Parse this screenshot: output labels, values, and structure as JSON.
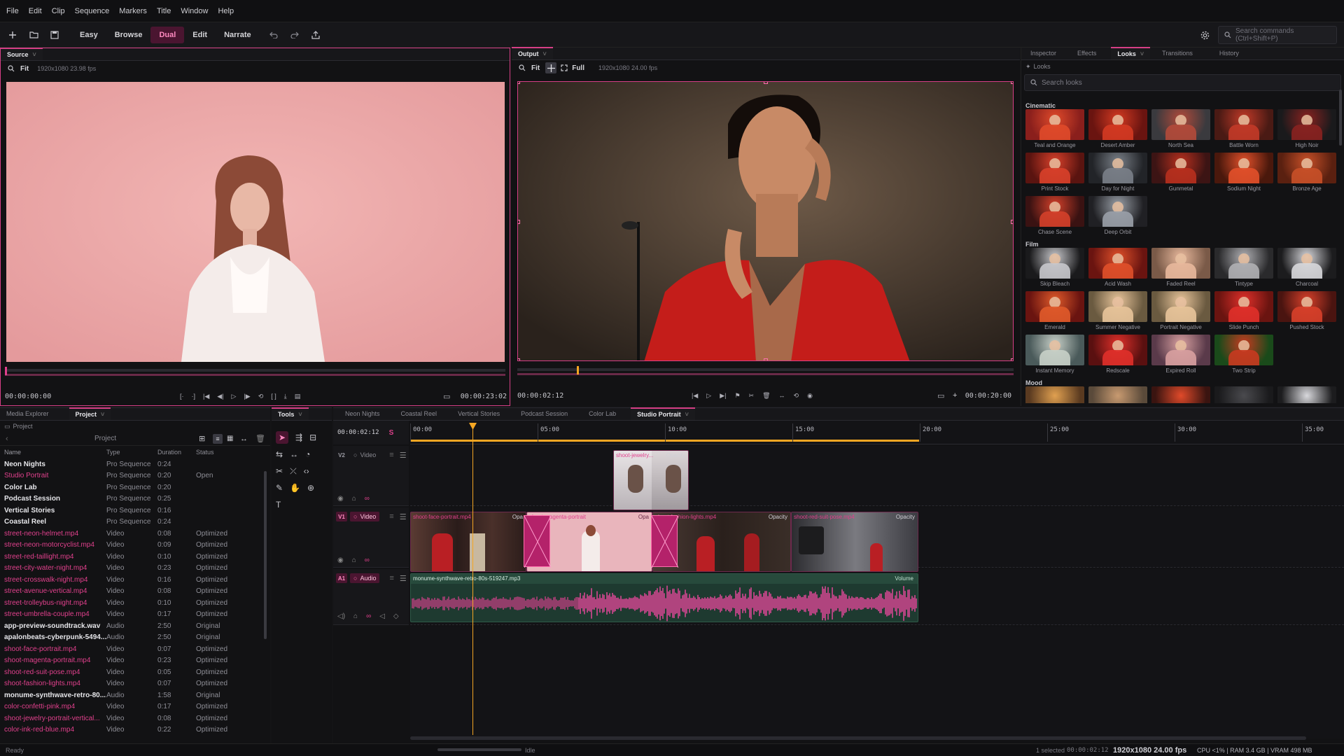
{
  "menu": [
    "File",
    "Edit",
    "Clip",
    "Sequence",
    "Markers",
    "Title",
    "Window",
    "Help"
  ],
  "toolbar": {
    "workspaces": [
      "Easy",
      "Browse",
      "Dual",
      "Edit",
      "Narrate"
    ],
    "active_workspace": "Dual",
    "search_placeholder": "Search commands (Ctrl+Shift+P)"
  },
  "source": {
    "tab": "Source",
    "fit": "Fit",
    "info": "1920x1080  23.98 fps",
    "timecode_in": "00:00:00:00",
    "timecode_out": "00:00:23:02",
    "progress": 0.0
  },
  "output": {
    "tab": "Output",
    "fit": "Fit",
    "full": "Full",
    "info": "1920x1080  24.00 fps",
    "timecode_in": "00:00:02:12",
    "timecode_out": "00:00:20:00",
    "progress": 0.12
  },
  "right_panel": {
    "tabs": [
      "Inspector",
      "Effects",
      "Looks",
      "Transitions",
      "History"
    ],
    "active_tab": "Looks",
    "crumb": "Looks",
    "search_placeholder": "Search looks",
    "sections": [
      {
        "title": "Cinematic",
        "items": [
          "Teal and Orange",
          "Desert Amber",
          "North Sea",
          "Battle Worn",
          "High Noir",
          "Print Stock",
          "Day for Night",
          "Gunmetal",
          "Sodium Night",
          "Bronze Age",
          "Chase Scene",
          "Deep Orbit"
        ]
      },
      {
        "title": "Film",
        "items": [
          "Skip Bleach",
          "Acid Wash",
          "Faded Reel",
          "Tintype",
          "Charcoal",
          "Emerald",
          "Summer Negative",
          "Portrait Negative",
          "Slide Punch",
          "Pushed Stock",
          "Instant Memory",
          "Redscale",
          "Expired Roll",
          "Two Strip"
        ]
      },
      {
        "title": "Mood",
        "items": []
      }
    ]
  },
  "project_panel": {
    "tabs": [
      "Media Explorer",
      "Project"
    ],
    "active_tab": "Project",
    "crumb": "Project",
    "header": "Project",
    "columns": [
      "Name",
      "Type",
      "Duration",
      "Status"
    ],
    "rows": [
      {
        "name": "Neon Nights",
        "type": "Pro Sequence",
        "duration": "0:24",
        "status": ""
      },
      {
        "name": "Studio Portrait",
        "type": "Pro Sequence",
        "duration": "0:20",
        "status": "Open"
      },
      {
        "name": "Color Lab",
        "type": "Pro Sequence",
        "duration": "0:20",
        "status": ""
      },
      {
        "name": "Podcast Session",
        "type": "Pro Sequence",
        "duration": "0:25",
        "status": ""
      },
      {
        "name": "Vertical Stories",
        "type": "Pro Sequence",
        "duration": "0:16",
        "status": ""
      },
      {
        "name": "Coastal Reel",
        "type": "Pro Sequence",
        "duration": "0:24",
        "status": ""
      },
      {
        "name": "street-neon-helmet.mp4",
        "type": "Video",
        "duration": "0:08",
        "status": "Optimized"
      },
      {
        "name": "street-neon-motorcyclist.mp4",
        "type": "Video",
        "duration": "0:09",
        "status": "Optimized"
      },
      {
        "name": "street-red-taillight.mp4",
        "type": "Video",
        "duration": "0:10",
        "status": "Optimized"
      },
      {
        "name": "street-city-water-night.mp4",
        "type": "Video",
        "duration": "0:23",
        "status": "Optimized"
      },
      {
        "name": "street-crosswalk-night.mp4",
        "type": "Video",
        "duration": "0:16",
        "status": "Optimized"
      },
      {
        "name": "street-avenue-vertical.mp4",
        "type": "Video",
        "duration": "0:08",
        "status": "Optimized"
      },
      {
        "name": "street-trolleybus-night.mp4",
        "type": "Video",
        "duration": "0:10",
        "status": "Optimized"
      },
      {
        "name": "street-umbrella-couple.mp4",
        "type": "Video",
        "duration": "0:17",
        "status": "Optimized"
      },
      {
        "name": "app-preview-soundtrack.wav",
        "type": "Audio",
        "duration": "2:50",
        "status": "Original"
      },
      {
        "name": "apalonbeats-cyberpunk-5494...",
        "type": "Audio",
        "duration": "2:50",
        "status": "Original"
      },
      {
        "name": "shoot-face-portrait.mp4",
        "type": "Video",
        "duration": "0:07",
        "status": "Optimized"
      },
      {
        "name": "shoot-magenta-portrait.mp4",
        "type": "Video",
        "duration": "0:23",
        "status": "Optimized"
      },
      {
        "name": "shoot-red-suit-pose.mp4",
        "type": "Video",
        "duration": "0:05",
        "status": "Optimized"
      },
      {
        "name": "shoot-fashion-lights.mp4",
        "type": "Video",
        "duration": "0:07",
        "status": "Optimized"
      },
      {
        "name": "monume-synthwave-retro-80...",
        "type": "Audio",
        "duration": "1:58",
        "status": "Original"
      },
      {
        "name": "color-confetti-pink.mp4",
        "type": "Video",
        "duration": "0:17",
        "status": "Optimized"
      },
      {
        "name": "shoot-jewelry-portrait-vertical...",
        "type": "Video",
        "duration": "0:08",
        "status": "Optimized"
      },
      {
        "name": "color-ink-red-blue.mp4",
        "type": "Video",
        "duration": "0:22",
        "status": "Optimized"
      }
    ]
  },
  "tools": {
    "tab": "Tools"
  },
  "timeline": {
    "tabs": [
      "Neon Nights",
      "Coastal Reel",
      "Vertical Stories",
      "Podcast Session",
      "Color Lab",
      "Studio Portrait"
    ],
    "active_tab": "Studio Portrait",
    "timecode": "00:00:02:12",
    "ruler": [
      "00:00",
      "05:00",
      "10:00",
      "15:00",
      "20:00",
      "25:00",
      "30:00",
      "35:00"
    ],
    "tracks": [
      {
        "id": "V2",
        "name": "Video"
      },
      {
        "id": "V1",
        "name": "Video"
      },
      {
        "id": "A1",
        "name": "Audio"
      }
    ],
    "v2_clip": {
      "label": "shoot-jewelry...",
      "param": "Opacity"
    },
    "v1_clips": [
      {
        "label": "shoot-face-portrait.mp4",
        "param": "Opa"
      },
      {
        "label": "shoot-magenta-portrait",
        "param": "Opa"
      },
      {
        "label": "shoot-fashion-lights.mp4",
        "param": "Opacity"
      },
      {
        "label": "shoot-red-suit-pose.mp4",
        "param": "Opacity"
      }
    ],
    "a1_clip": {
      "label": "monume-synthwave-retro-80s-519247.mp3",
      "param": "Volume"
    }
  },
  "status": {
    "left": "Ready",
    "middle": "Idle",
    "selected": "1 selected",
    "sel_tc": "00:00:02:12",
    "format": "1920x1080  24.00 fps",
    "stats": "CPU <1%  |  RAM 3.4 GB  |  VRAM 498 MB"
  },
  "colors": {
    "accent": "#e0408c",
    "playhead": "#f5a623",
    "bg": "#141416"
  }
}
